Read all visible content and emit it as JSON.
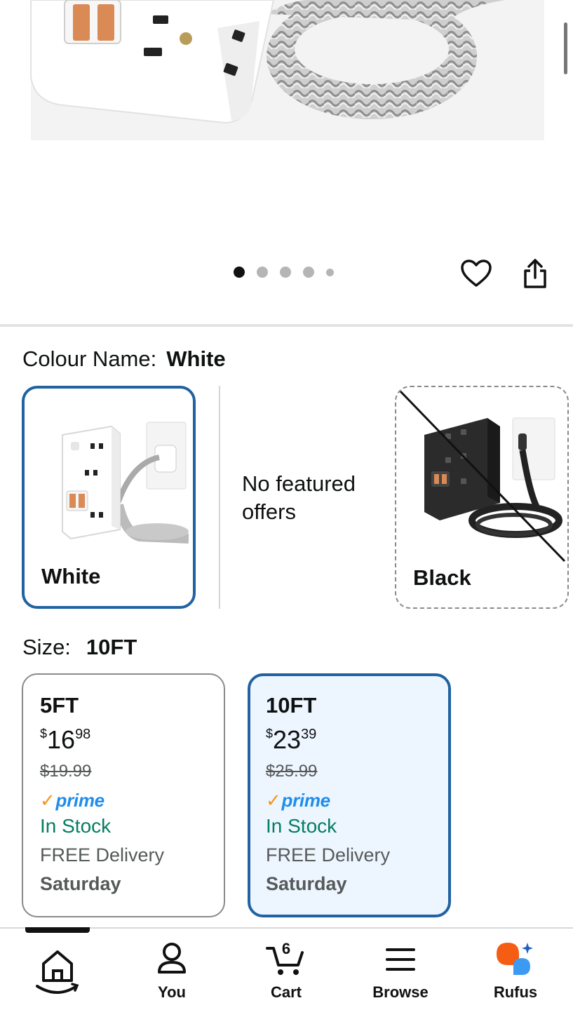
{
  "pager": {
    "count": 5,
    "active": 0
  },
  "colour": {
    "label": "Colour Name:",
    "selected": "White",
    "options": [
      {
        "name": "White"
      },
      {
        "name": "Black"
      }
    ],
    "no_offers": "No featured offers"
  },
  "size": {
    "label": "Size:",
    "selected": "10FT",
    "options": [
      {
        "name": "5FT",
        "currency": "$",
        "whole": "16",
        "fraction": "98",
        "was": "$19.99",
        "prime": "prime",
        "stock": "In Stock",
        "delivery": "FREE Delivery",
        "day": "Saturday"
      },
      {
        "name": "10FT",
        "currency": "$",
        "whole": "23",
        "fraction": "39",
        "was": "$25.99",
        "prime": "prime",
        "stock": "In Stock",
        "delivery": "FREE Delivery",
        "day": "Saturday"
      }
    ]
  },
  "nav": {
    "home": "",
    "you": "You",
    "cart": "Cart",
    "cart_count": "6",
    "browse": "Browse",
    "rufus": "Rufus"
  },
  "colors": {
    "selected_border": "#2162a1",
    "selected_bg": "#edf6ff",
    "in_stock": "#067d62",
    "prime_blue": "#1f8ded",
    "prime_check": "#f7941d"
  }
}
